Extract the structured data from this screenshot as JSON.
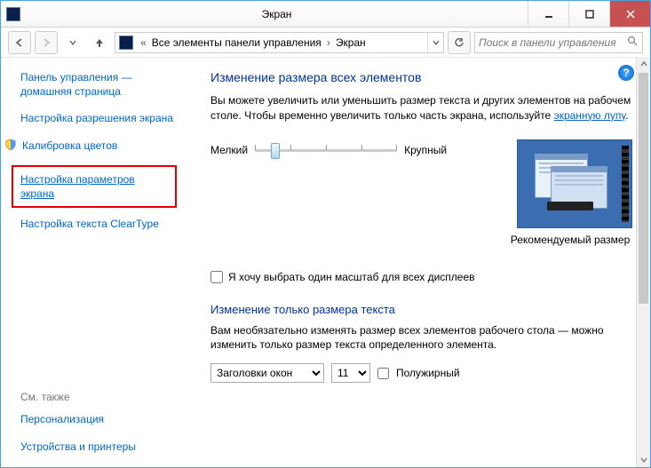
{
  "window": {
    "title": "Экран"
  },
  "nav": {
    "crumb1": "Все элементы панели управления",
    "crumb2": "Экран",
    "search_placeholder": "Поиск в панели управления"
  },
  "sidebar": {
    "home": "Панель управления — домашняя страница",
    "resolution": "Настройка разрешения экрана",
    "calibration": "Калибровка цветов",
    "screen_params": "Настройка параметров экрана",
    "cleartype": "Настройка текста ClearType",
    "see_also_heading": "См. также",
    "personalization": "Персонализация",
    "devices": "Устройства и принтеры"
  },
  "main": {
    "heading1": "Изменение размера всех элементов",
    "desc_part1": "Вы можете увеличить или уменьшить размер текста и других элементов на рабочем столе. Чтобы временно увеличить только часть экрана, используйте ",
    "desc_link": "экранную лупу",
    "desc_part2": ".",
    "slider_min": "Мелкий",
    "slider_max": "Крупный",
    "preview_caption": "Рекомендуемый размер",
    "checkbox_label": "Я хочу выбрать один масштаб для всех дисплеев",
    "heading2": "Изменение только размера текста",
    "desc2": "Вам необязательно изменять размер всех элементов рабочего стола — можно изменить только размер текста определенного элемента.",
    "select_element": "Заголовки окон",
    "select_size": "11",
    "bold_label": "Полужирный"
  }
}
